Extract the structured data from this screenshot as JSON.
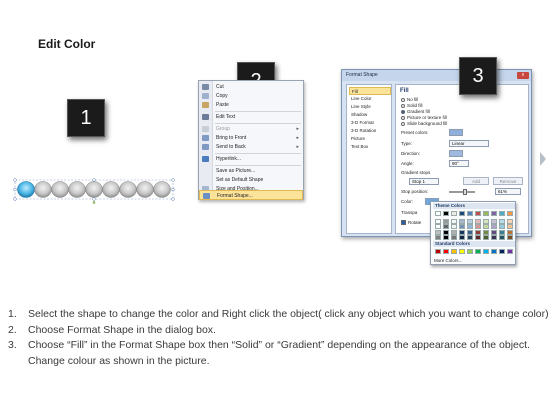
{
  "title": "Edit Color",
  "steps": [
    {
      "number": "1"
    },
    {
      "number": "2"
    },
    {
      "number": "3"
    }
  ],
  "context_menu": {
    "items": [
      {
        "label": "Cut",
        "icon": "scissors-icon",
        "enabled": true,
        "submenu": false
      },
      {
        "label": "Copy",
        "icon": "copy-icon",
        "enabled": true,
        "submenu": false
      },
      {
        "label": "Paste",
        "icon": "paste-icon",
        "enabled": true,
        "submenu": false
      },
      {
        "label": "Edit Text",
        "icon": "edit-text-icon",
        "enabled": true,
        "submenu": false
      },
      {
        "label": "Group",
        "icon": "group-icon",
        "enabled": false,
        "submenu": true
      },
      {
        "label": "Bring to Front",
        "icon": "bring-front-icon",
        "enabled": true,
        "submenu": true
      },
      {
        "label": "Send to Back",
        "icon": "send-back-icon",
        "enabled": true,
        "submenu": true
      },
      {
        "label": "Hyperlink...",
        "icon": "hyperlink-icon",
        "enabled": true,
        "submenu": false
      },
      {
        "label": "Save as Picture...",
        "icon": "picture-icon",
        "enabled": true,
        "submenu": false
      },
      {
        "label": "Set as Default Shape",
        "icon": "default-shape-icon",
        "enabled": true,
        "submenu": false
      },
      {
        "label": "Size and Position...",
        "icon": "size-icon",
        "enabled": true,
        "submenu": false
      },
      {
        "label": "Format Shape...",
        "icon": "format-shape-icon",
        "enabled": true,
        "submenu": false,
        "highlighted": true
      }
    ]
  },
  "dialog": {
    "title": "Format Shape",
    "close_label": "x",
    "nav": [
      "Fill",
      "Line Color",
      "Line Style",
      "Shadow",
      "3-D Format",
      "3-D Rotation",
      "Picture",
      "Text Box"
    ],
    "fill_header": "Fill",
    "fill_options": [
      {
        "label": "No fill",
        "selected": false
      },
      {
        "label": "Solid fill",
        "selected": false
      },
      {
        "label": "Gradient fill",
        "selected": true
      },
      {
        "label": "Picture or texture fill",
        "selected": false
      },
      {
        "label": "Slide background fill",
        "selected": false
      }
    ],
    "preset_colors_label": "Preset colors:",
    "type_label": "Type:",
    "type_value": "Linear",
    "direction_label": "Direction:",
    "angle_label": "Angle:",
    "angle_value": "90°",
    "gradient_stops_label": "Gradient stops",
    "stop_value": "Stop 1",
    "add_label": "Add",
    "remove_label": "Remove",
    "stop_position_label": "Stop position:",
    "stop_position_value": "61%",
    "color_label": "Color:",
    "transparency_label": "Transpa",
    "rotate_label": "Rotate"
  },
  "palette": {
    "theme_header": "Theme Colors",
    "standard_header": "Standard Colors",
    "more_colors": "More Colors...",
    "theme_top": [
      "#ffffff",
      "#000000",
      "#eeece1",
      "#1f497d",
      "#4f81bd",
      "#c0504d",
      "#9bbb59",
      "#8064a2",
      "#4bacc6",
      "#f79646"
    ],
    "standard": [
      "#c00000",
      "#ff0000",
      "#ffc000",
      "#ffff00",
      "#92d050",
      "#00b050",
      "#00b0f0",
      "#0070c0",
      "#002060",
      "#7030a0"
    ]
  },
  "instructions": [
    {
      "num": "1.",
      "text": "Select the shape to change the color and Right click the object( click any object which you want to change color)"
    },
    {
      "num": "2.",
      "text": "Choose Format Shape in the dialog box."
    },
    {
      "num": "3.",
      "text": "Choose “Fill” in the Format Shape box then “Solid” or “Gradient” depending on the appearance of the object. Change colour as shown in the picture."
    }
  ]
}
